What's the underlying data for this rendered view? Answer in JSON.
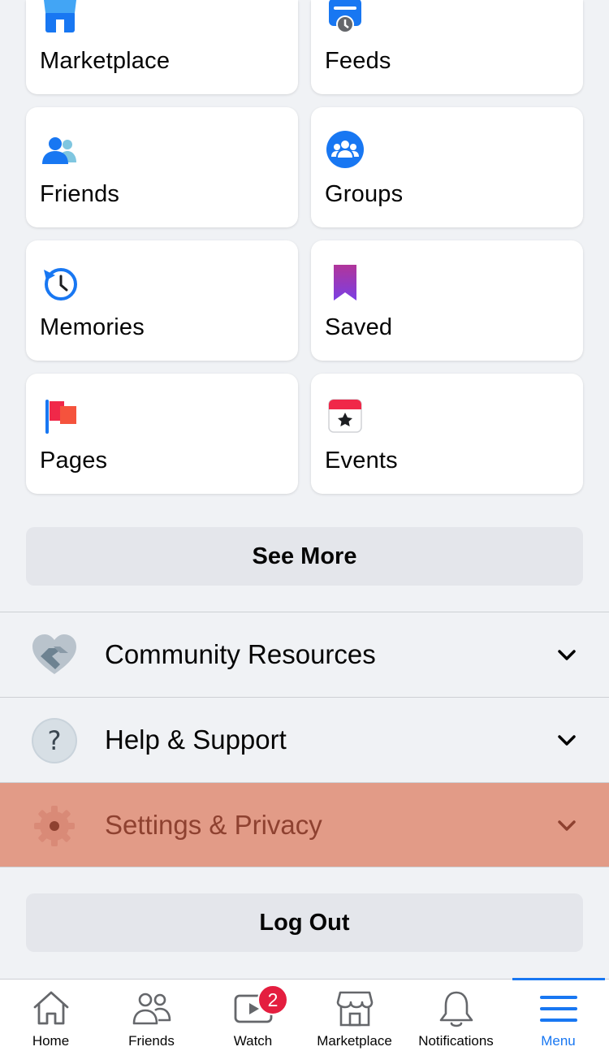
{
  "shortcuts": [
    {
      "label": "Marketplace",
      "icon": "marketplace-icon"
    },
    {
      "label": "Feeds",
      "icon": "feeds-icon"
    },
    {
      "label": "Friends",
      "icon": "friends-icon"
    },
    {
      "label": "Groups",
      "icon": "groups-icon"
    },
    {
      "label": "Memories",
      "icon": "memories-icon"
    },
    {
      "label": "Saved",
      "icon": "saved-icon"
    },
    {
      "label": "Pages",
      "icon": "pages-icon"
    },
    {
      "label": "Events",
      "icon": "events-icon"
    }
  ],
  "see_more_label": "See More",
  "sections": [
    {
      "label": "Community Resources",
      "icon": "handshake-icon"
    },
    {
      "label": "Help & Support",
      "icon": "question-icon"
    },
    {
      "label": "Settings & Privacy",
      "icon": "gear-icon"
    }
  ],
  "logout_label": "Log Out",
  "tabbar": {
    "tabs": [
      {
        "label": "Home",
        "icon": "home-icon"
      },
      {
        "label": "Friends",
        "icon": "friends-outline-icon"
      },
      {
        "label": "Watch",
        "icon": "watch-icon",
        "badge": "2"
      },
      {
        "label": "Marketplace",
        "icon": "marketplace-outline-icon"
      },
      {
        "label": "Notifications",
        "icon": "bell-icon"
      },
      {
        "label": "Menu",
        "icon": "menu-icon",
        "active": true
      }
    ]
  },
  "colors": {
    "accent": "#1877f2",
    "highlight": "#e29b87",
    "badge": "#e41e3f"
  }
}
